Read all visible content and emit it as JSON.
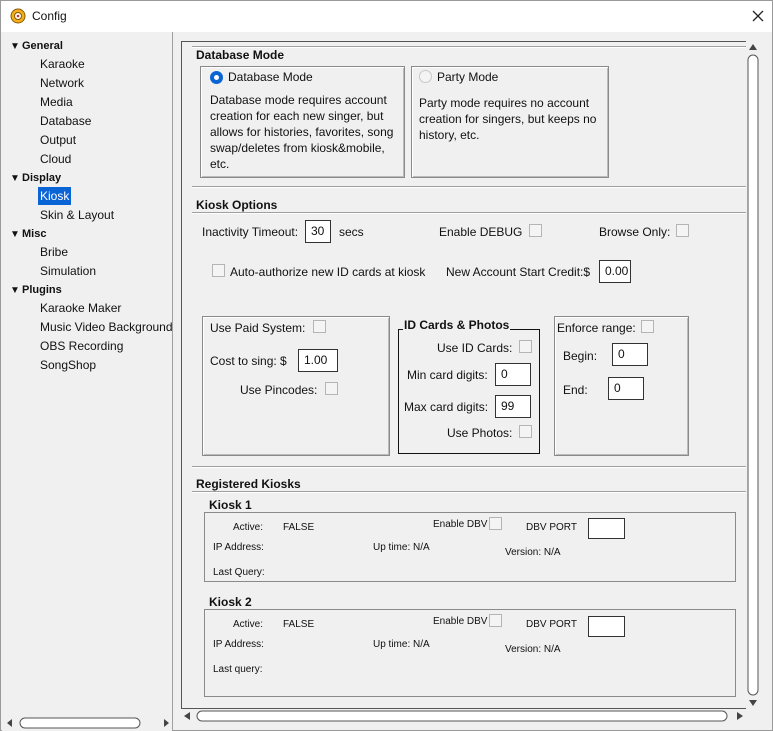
{
  "window": {
    "title": "Config"
  },
  "sidebar": {
    "categories": [
      {
        "label": "General",
        "items": [
          "Karaoke",
          "Network",
          "Media",
          "Database",
          "Output",
          "Cloud"
        ]
      },
      {
        "label": "Display",
        "items": [
          "Kiosk",
          "Skin & Layout"
        ]
      },
      {
        "label": "Misc",
        "items": [
          "Bribe",
          "Simulation"
        ]
      },
      {
        "label": "Plugins",
        "items": [
          "Karaoke Maker",
          "Music Video Background",
          "OBS Recording",
          "SongShop"
        ]
      }
    ],
    "selected": "Kiosk"
  },
  "database_mode": {
    "section_title": "Database Mode",
    "db_option": {
      "label": "Database Mode",
      "selected": true,
      "desc": "Database mode requires account creation for each new singer, but allows for histories, favorites, song swap/deletes from kiosk&mobile, etc."
    },
    "party_option": {
      "label": "Party Mode",
      "selected": false,
      "desc": "Party mode requires no account creation for singers, but keeps no history, etc."
    }
  },
  "kiosk_options": {
    "section_title": "Kiosk Options",
    "inactivity_label": "Inactivity Timeout:",
    "inactivity_value": "30",
    "inactivity_unit": "secs",
    "enable_debug_label": "Enable DEBUG",
    "browse_only_label": "Browse Only:",
    "auto_authorize_label": "Auto-authorize new ID cards at kiosk",
    "start_credit_label": "New Account Start Credit:$",
    "start_credit_value": "0.00",
    "paid": {
      "use_paid_label": "Use Paid System:",
      "cost_label": "Cost to sing: $",
      "cost_value": "1.00",
      "pincodes_label": "Use Pincodes:"
    },
    "id_cards": {
      "title": "ID Cards & Photos",
      "use_id_label": "Use ID Cards:",
      "min_label": "Min card digits:",
      "min_value": "0",
      "max_label": "Max card digits:",
      "max_value": "99",
      "photos_label": "Use Photos:"
    },
    "range": {
      "enforce_label": "Enforce range:",
      "begin_label": "Begin:",
      "begin_value": "0",
      "end_label": "End:",
      "end_value": "0"
    }
  },
  "registered_kiosks": {
    "section_title": "Registered Kiosks",
    "kiosks": [
      {
        "name": "Kiosk 1",
        "active_label": "Active:",
        "active_value": "FALSE",
        "enable_dbv_label": "Enable DBV",
        "dbv_port_label": "DBV PORT",
        "ip_label": "IP Address:",
        "uptime_label": "Up time: N/A",
        "version_label": "Version: N/A",
        "last_query_label": "Last Query:"
      },
      {
        "name": "Kiosk 2",
        "active_label": "Active:",
        "active_value": "FALSE",
        "enable_dbv_label": "Enable DBV",
        "dbv_port_label": "DBV PORT",
        "ip_label": "IP Address:",
        "uptime_label": "Up time: N/A",
        "version_label": "Version: N/A",
        "last_query_label": "Last query:"
      }
    ]
  }
}
